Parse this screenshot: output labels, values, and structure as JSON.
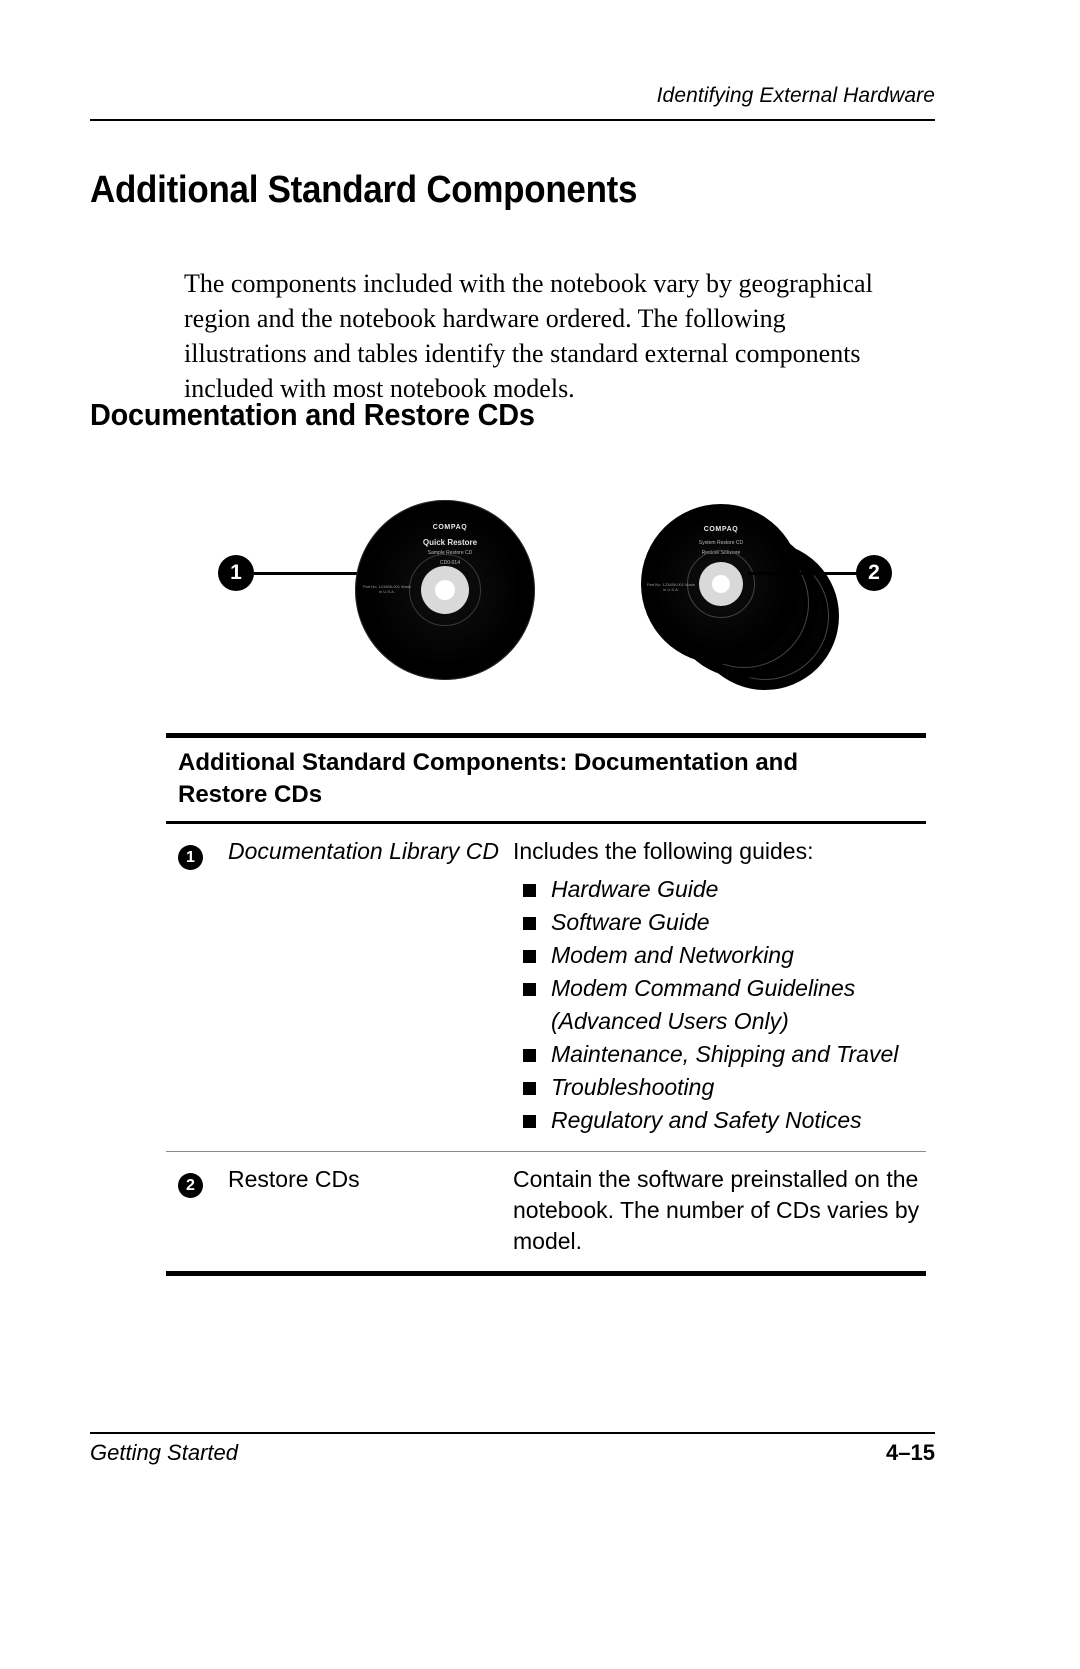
{
  "running_head": "Identifying External Hardware",
  "headings": {
    "h1": "Additional Standard Components",
    "h2": "Documentation and Restore CDs"
  },
  "intro_paragraph": "The components included with the notebook vary by geographical region and the notebook hardware ordered. The following illustrations and tables identify the standard external components included with most notebook models.",
  "figure": {
    "callout_1": "1",
    "callout_2": "2",
    "disc_label": {
      "brand": "COMPAQ",
      "title": "Quick Restore",
      "subtitle": "Sample Restore CD",
      "code": "CD0-014",
      "side_text": "Part No. 123456-001 Made in U.S.A."
    },
    "stack_label": {
      "brand": "COMPAQ",
      "title": "System Restore CD",
      "subtitle": "Restore Software",
      "side_text": "Part No. 123456-001 Made in U.S.A."
    }
  },
  "table": {
    "caption": "Additional Standard Components: Documentation and Restore CDs",
    "rows": [
      {
        "number": "1",
        "name": "Documentation Library CD",
        "name_italic": true,
        "description_intro": "Includes the following guides:",
        "guides": [
          "Hardware Guide",
          "Software Guide",
          "Modem and Networking",
          "Modem Command Guidelines (Advanced Users Only)",
          "Maintenance, Shipping and Travel",
          "Troubleshooting",
          "Regulatory and Safety Notices"
        ]
      },
      {
        "number": "2",
        "name": "Restore CDs",
        "name_italic": false,
        "description_intro": "Contain the software preinstalled on the notebook. The number of CDs varies by model.",
        "guides": []
      }
    ]
  },
  "footer": {
    "left": "Getting Started",
    "right": "4–15"
  },
  "colors": {
    "text": "#000000",
    "page_background": "#ffffff",
    "rule": "#000000",
    "thin_rule": "#8a8a8a"
  }
}
